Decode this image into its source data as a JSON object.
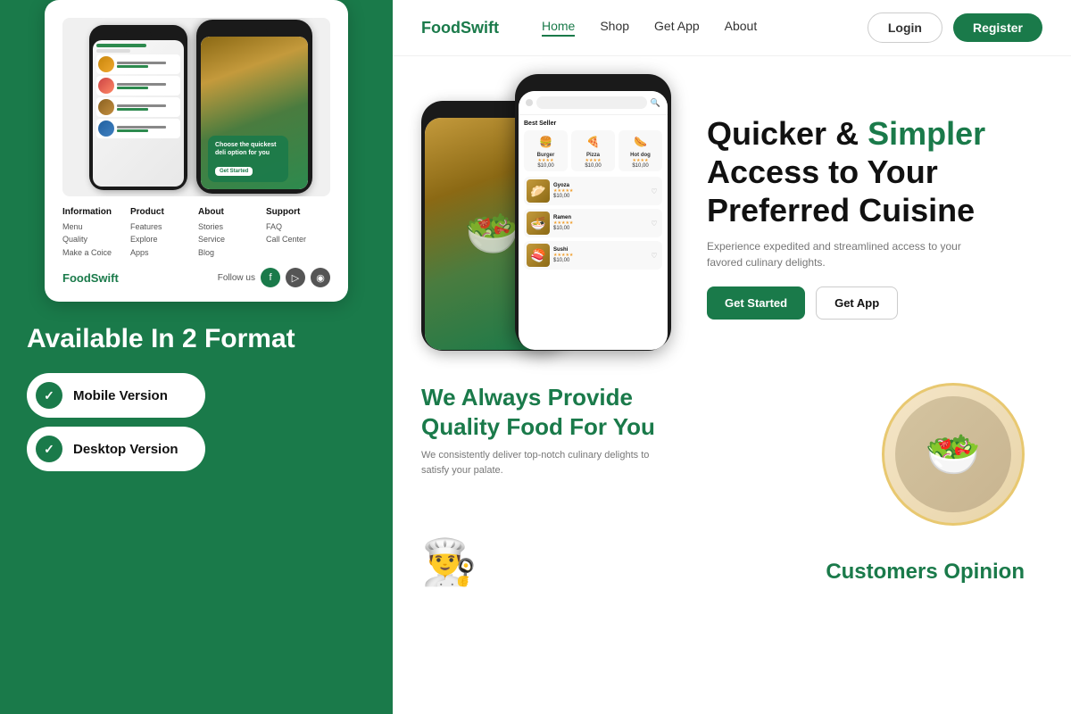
{
  "left": {
    "available_title": "Available In 2 Format",
    "mobile_label": "Mobile Version",
    "desktop_label": "Desktop Version",
    "preview": {
      "footer": {
        "cols": [
          {
            "heading": "Information",
            "items": [
              "Menu",
              "Quality",
              "Make a Coice"
            ]
          },
          {
            "heading": "Product",
            "items": [
              "Features",
              "Explore",
              "Apps"
            ]
          },
          {
            "heading": "About",
            "items": [
              "Stories",
              "Service",
              "Blog"
            ]
          },
          {
            "heading": "Support",
            "items": [
              "FAQ",
              "Call Center"
            ]
          }
        ],
        "brand": "FoodSwift",
        "follow_us": "Follow us"
      }
    }
  },
  "nav": {
    "brand": "FoodSwift",
    "links": [
      "Home",
      "Shop",
      "Get App",
      "About"
    ],
    "active_link": "Home",
    "login_label": "Login",
    "register_label": "Register"
  },
  "hero": {
    "title_part1": "Quicker & ",
    "title_green": "Simpler",
    "title_part2": "Access to Your Preferred Cuisine",
    "subtitle": "Experience expedited and streamlined access to your favored culinary delights.",
    "btn_get_started": "Get Started",
    "btn_get_app": "Get App",
    "bestseller": "Best Seller",
    "food_items": [
      {
        "name": "Burger",
        "price": "$10,00",
        "emoji": "🍔"
      },
      {
        "name": "Pizza",
        "price": "$10,00",
        "emoji": "🍕"
      },
      {
        "name": "Hot dog",
        "price": "$10,00",
        "emoji": "🌭"
      }
    ],
    "scroll_items": [
      {
        "name": "Gyoza",
        "price": "$10,00",
        "emoji": "🥟"
      },
      {
        "name": "Ramen",
        "price": "$10,00",
        "emoji": "🍜"
      },
      {
        "name": "Sushi",
        "price": "$10,00",
        "emoji": "🍣"
      }
    ],
    "green_card_text": "Choose the quickest deli option for you",
    "green_cta": "Get Started"
  },
  "quality": {
    "title": "We Always Provide\nQuality Food For You",
    "subtitle": "We consistently deliver top-notch culinary delights to satisfy your palate.",
    "emoji": "🥗"
  },
  "customers": {
    "title": "Customers Opinion"
  },
  "social": {
    "icons": [
      "F",
      "▷",
      "◉"
    ]
  }
}
